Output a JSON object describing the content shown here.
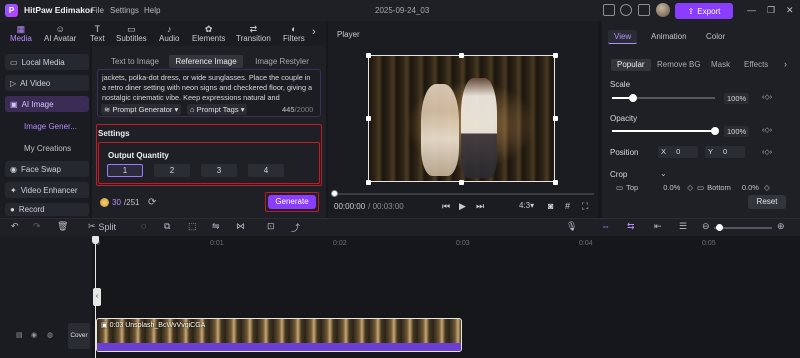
{
  "app": {
    "title": "HitPaw Edimakor",
    "project_name": "2025-09-24_03"
  },
  "menu": [
    "File",
    "Settings",
    "Help"
  ],
  "titlebar": {
    "export_label": "Export",
    "window_controls": [
      "—",
      "❐",
      "✕"
    ]
  },
  "toolbar": [
    {
      "label": "Media",
      "icon": "media-icon",
      "glyph": "▦"
    },
    {
      "label": "AI Avatar",
      "icon": "avatar-icon",
      "glyph": "☺"
    },
    {
      "label": "Text",
      "icon": "text-icon",
      "glyph": "T"
    },
    {
      "label": "Subtitles",
      "icon": "subtitles-icon",
      "glyph": "▭"
    },
    {
      "label": "Audio",
      "icon": "audio-icon",
      "glyph": "♪"
    },
    {
      "label": "Elements",
      "icon": "elements-icon",
      "glyph": "✿"
    },
    {
      "label": "Transition",
      "icon": "transition-icon",
      "glyph": "⇄"
    },
    {
      "label": "Filters",
      "icon": "filters-icon",
      "glyph": "◐"
    }
  ],
  "sidebar": {
    "items": [
      {
        "label": "Local Media"
      },
      {
        "label": "AI Video"
      },
      {
        "label": "AI Image"
      },
      {
        "label": "Image Gener..."
      },
      {
        "label": "My Creations"
      },
      {
        "label": "Face Swap"
      },
      {
        "label": "Video Enhancer"
      },
      {
        "label": "Record"
      }
    ]
  },
  "panel": {
    "tabs": [
      "Text to Image",
      "Reference Image",
      "Image Restyler"
    ],
    "prompt_text": "jackets, polka-dot dress, or wide sunglasses. Place the couple in a retro diner setting with neon signs and checkered floor, giving a nostalgic cinematic vibe. Keep expressions natural and",
    "prompt_generator_label": "Prompt Generator",
    "prompt_tags_label": "Prompt Tags",
    "char_count": "445",
    "char_max": "/2000",
    "settings_title": "Settings",
    "output_quantity_title": "Output Quantity",
    "quantities": [
      "1",
      "2",
      "3",
      "4"
    ],
    "credits_current": "30",
    "credits_total": "/251",
    "generate_label": "Generate"
  },
  "player": {
    "label": "Player",
    "time_current": "00:00:00",
    "time_total": "/ 00:03:00",
    "aspect": "4:3",
    "progress": 0.0
  },
  "properties": {
    "tabs": [
      "View",
      "Animation",
      "Color"
    ],
    "subtabs": [
      "Popular",
      "Remove BG",
      "Mask",
      "Effects"
    ],
    "scale_label": "Scale",
    "scale_value": "100%",
    "scale_level": 0.2,
    "opacity_label": "Opacity",
    "opacity_value": "100%",
    "opacity_level": 1.0,
    "position_label": "Position",
    "pos_x_label": "X",
    "pos_x_value": "0",
    "pos_y_label": "Y",
    "pos_y_value": "0",
    "crop_label": "Crop",
    "crop_top_label": "Top",
    "crop_top_value": "0.0%",
    "crop_bottom_label": "Bottom",
    "crop_bottom_value": "0.0%",
    "reset_label": "Reset"
  },
  "timeline": {
    "split_label": "Split",
    "ruler": [
      "0",
      "0:01",
      "0:02",
      "0:03",
      "0:04",
      "0:05"
    ],
    "clip_name": "0:03 Unsplash_BcWvVvqiCGA",
    "cover_label": "Cover"
  },
  "colors": {
    "accent": "#8a3cff",
    "highlight_border": "#c01b2a",
    "active_text": "#b48cff"
  }
}
